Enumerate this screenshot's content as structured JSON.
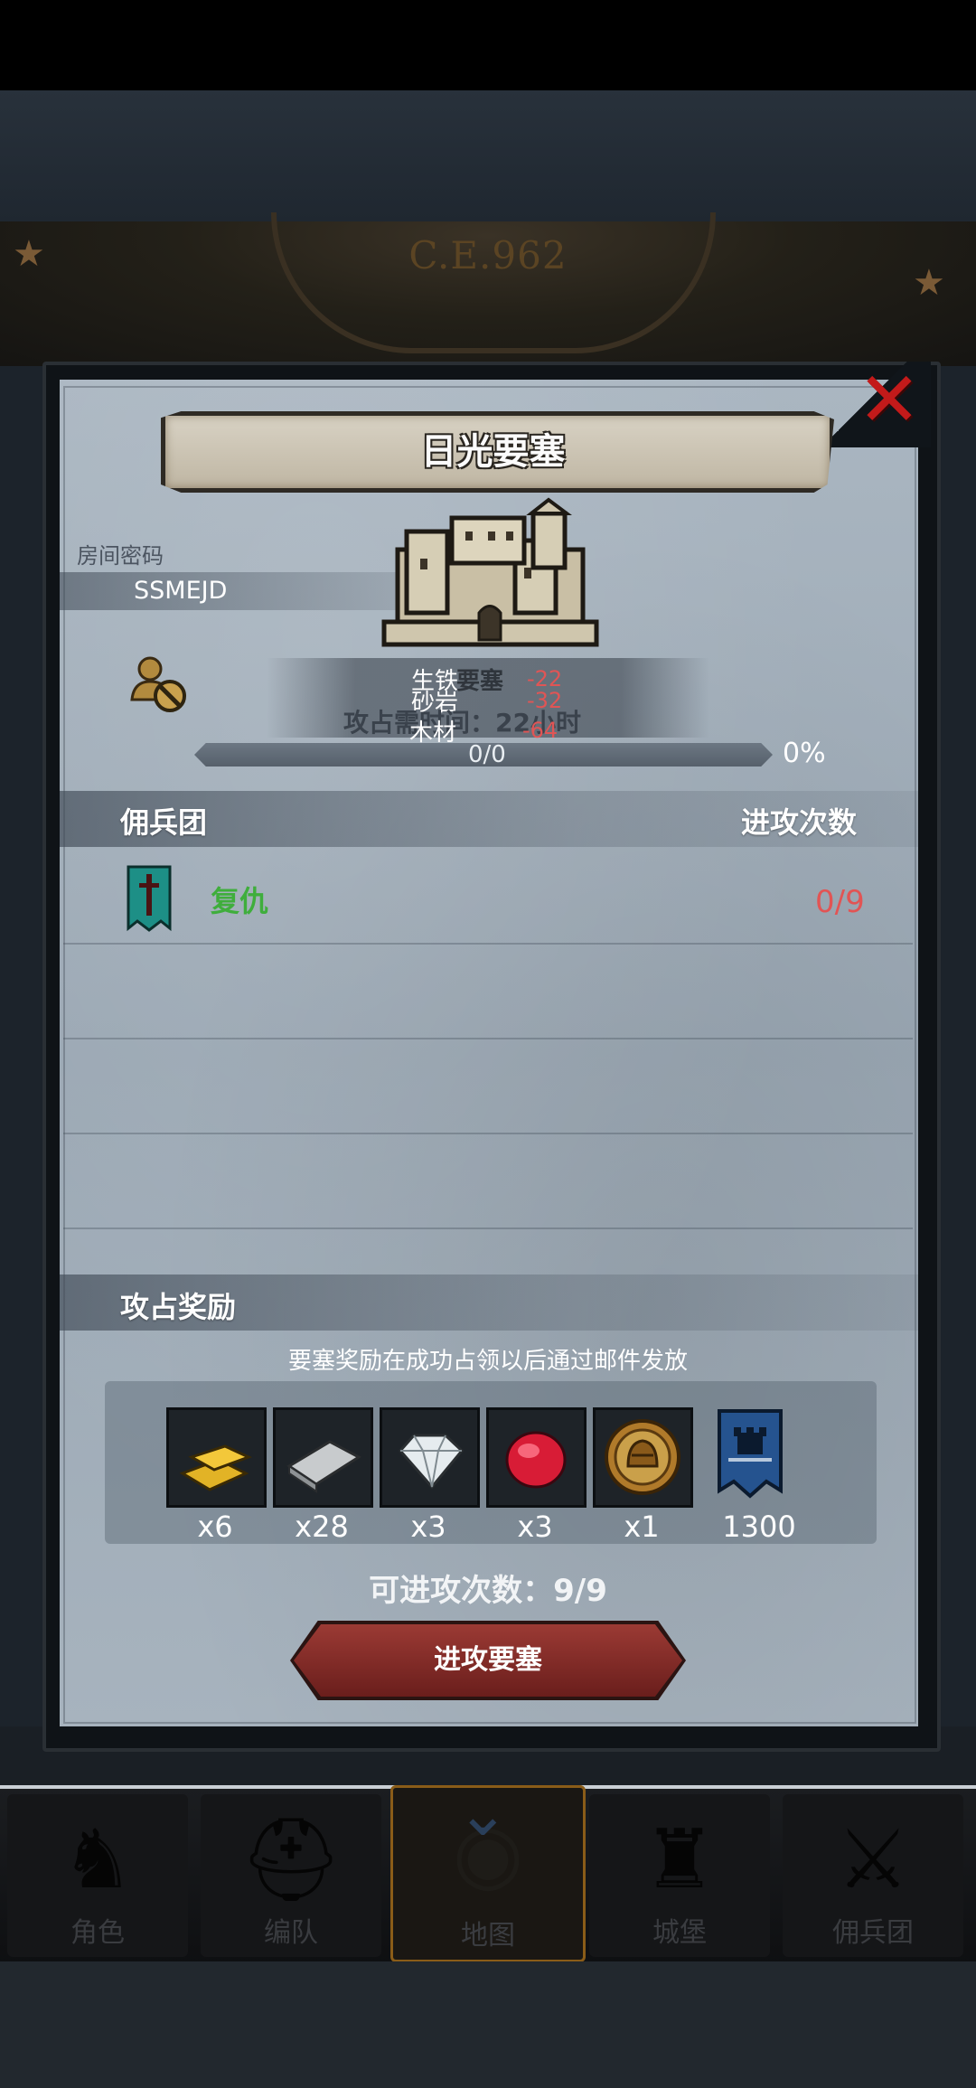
{
  "header": {
    "era": "C.E.962"
  },
  "dialog": {
    "title": "日光要塞",
    "room_label": "房间密码",
    "room_code": "SSMEJD",
    "fort_label": "要塞",
    "overlay": {
      "iron_label": "生铁",
      "iron_value": "-22",
      "sand_label": "砂岩",
      "sand_value": "-32",
      "wood_label": "木材",
      "wood_value": "-64",
      "attack_time": "攻占需时间：22小时"
    },
    "progress": {
      "count": "0/0",
      "percent": "0%",
      "value": 0
    },
    "mercenary_header": "佣兵团",
    "attack_count_header": "进攻次数",
    "mercenaries": [
      {
        "name": "复仇",
        "attacks": "0/9"
      }
    ],
    "reward_header": "攻占奖励",
    "reward_note": "要塞奖励在成功占领以后通过邮件发放",
    "rewards": [
      {
        "icon": "gold-bar-icon",
        "qty": "x6"
      },
      {
        "icon": "iron-bar-icon",
        "qty": "x28"
      },
      {
        "icon": "diamond-icon",
        "qty": "x3"
      },
      {
        "icon": "ruby-icon",
        "qty": "x3"
      },
      {
        "icon": "helmet-medal-icon",
        "qty": "x1"
      },
      {
        "icon": "guild-banner-icon",
        "qty": "1300"
      }
    ],
    "attempts_text": "可进攻次数：9/9",
    "attack_button": "进攻要塞"
  },
  "bottom_nav": {
    "items": [
      {
        "label": "角色",
        "icon": "knight-icon"
      },
      {
        "label": "编队",
        "icon": "helmet-icon"
      },
      {
        "label": "地图",
        "icon": "map-icon",
        "active": true
      },
      {
        "label": "城堡",
        "icon": "castle-icon"
      },
      {
        "label": "佣兵团",
        "icon": "mercenary-icon"
      }
    ]
  },
  "colors": {
    "accent_green": "#3fae3c",
    "accent_red": "#e25454",
    "button_red": "#9b3a34",
    "active_nav_border": "#8a5c18"
  }
}
